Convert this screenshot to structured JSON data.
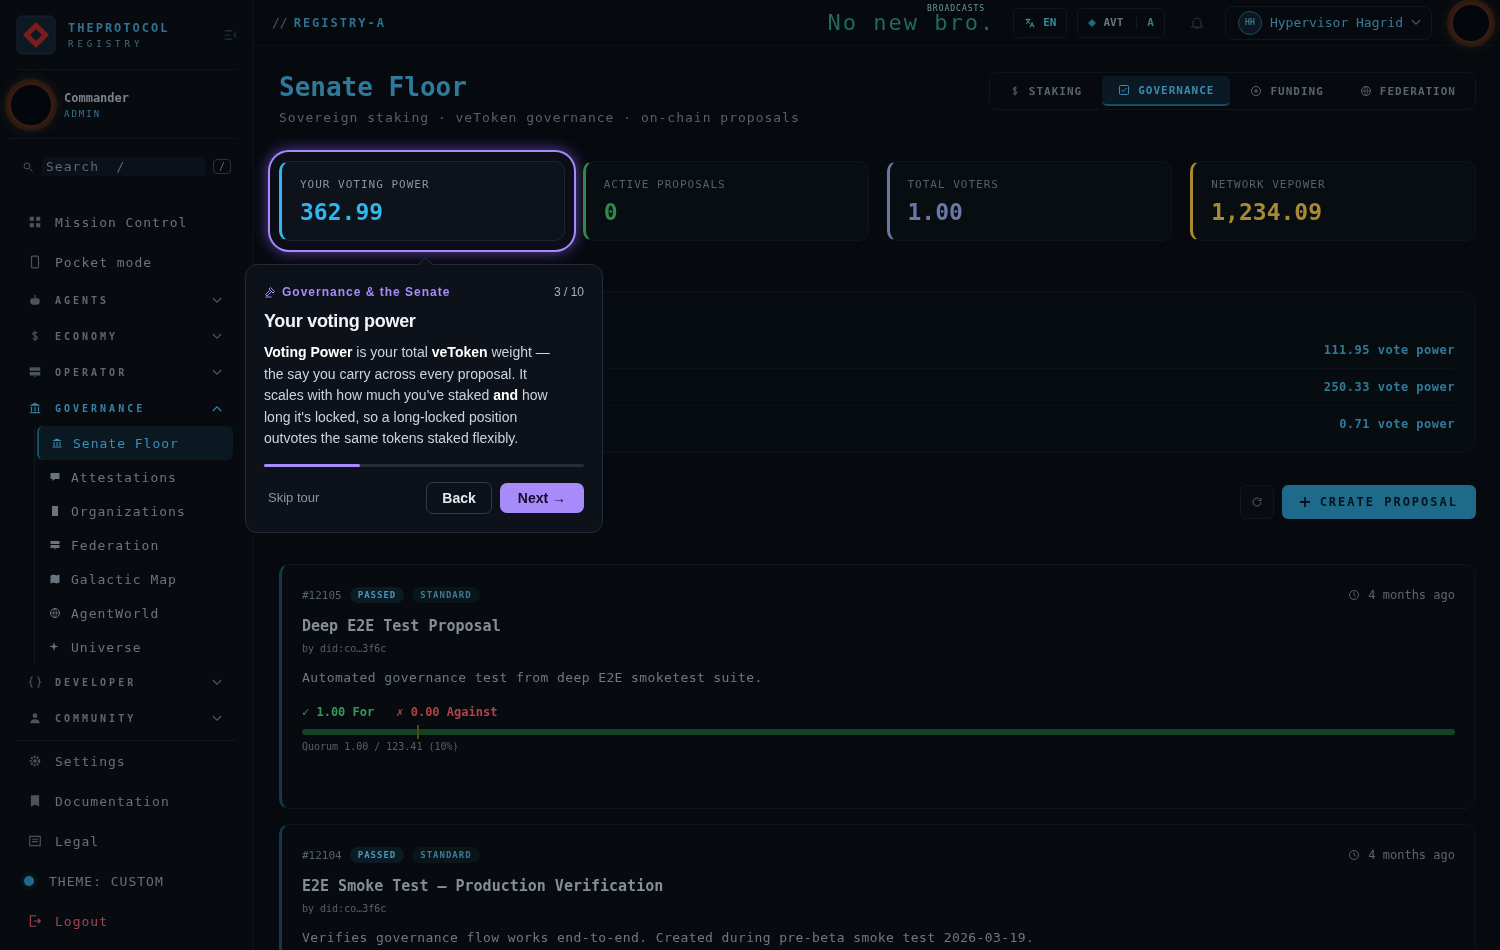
{
  "brand": {
    "name": "THEPROTOCOL",
    "sub": "REGISTRY"
  },
  "user": {
    "name": "Commander",
    "role": "ADMIN"
  },
  "search": {
    "placeholder": "Search  /",
    "shortcut": "/"
  },
  "nav": [
    {
      "kind": "link",
      "label": "Mission Control",
      "selected": false
    },
    {
      "kind": "link",
      "label": "Pocket mode",
      "selected": false
    },
    {
      "kind": "section",
      "label": "AGENTS",
      "expanded": false
    },
    {
      "kind": "section",
      "label": "ECONOMY",
      "expanded": false
    },
    {
      "kind": "section",
      "label": "OPERATOR",
      "expanded": false
    },
    {
      "kind": "section",
      "label": "GOVERNANCE",
      "expanded": true,
      "children": [
        {
          "label": "Senate Floor",
          "selected": true
        },
        {
          "label": "Attestations",
          "selected": false
        },
        {
          "label": "Organizations",
          "selected": false
        },
        {
          "label": "Federation",
          "selected": false
        },
        {
          "label": "Galactic Map",
          "selected": false
        },
        {
          "label": "AgentWorld",
          "selected": false
        },
        {
          "label": "Universe",
          "selected": false
        }
      ]
    },
    {
      "kind": "section",
      "label": "DEVELOPER",
      "expanded": false
    },
    {
      "kind": "section",
      "label": "COMMUNITY",
      "expanded": false
    }
  ],
  "footer": [
    {
      "kind": "link",
      "label": "Settings"
    },
    {
      "kind": "link",
      "label": "Documentation"
    },
    {
      "kind": "link",
      "label": "Legal"
    },
    {
      "kind": "theme",
      "label": "THEME: CUSTOM"
    },
    {
      "kind": "logout",
      "label": "Logout"
    }
  ],
  "header": {
    "prefix": "//",
    "crumb": "REGISTRY-A",
    "ticker_label": "BROADCASTS",
    "ticker": "No new bro.",
    "lang": "EN",
    "token": "AVT",
    "token_sub": "A",
    "user_initials": "HH",
    "user_name": "Hypervisor Hagrid"
  },
  "page": {
    "title": "Senate Floor",
    "subtitle": "Sovereign staking · veToken governance · on-chain proposals"
  },
  "tabs": [
    {
      "label": "STAKING",
      "selected": false
    },
    {
      "label": "GOVERNANCE",
      "selected": true
    },
    {
      "label": "FUNDING",
      "selected": false
    },
    {
      "label": "FEDERATION",
      "selected": false
    }
  ],
  "stats": [
    {
      "label": "YOUR VOTING POWER",
      "value": "362.99",
      "color": "#2fb8ee",
      "highlighted": true
    },
    {
      "label": "ACTIVE PROPOSALS",
      "value": "0",
      "color": "#2e8a48",
      "highlighted": false
    },
    {
      "label": "TOTAL VOTERS",
      "value": "1.00",
      "color": "#6a78a8",
      "highlighted": false
    },
    {
      "label": "NETWORK VEPOWER",
      "value": "1,234.09",
      "color": "#a88a30",
      "highlighted": false
    }
  ],
  "power_rows": [
    "111.95 vote power",
    "250.33 vote power",
    "0.71 vote power"
  ],
  "actions": {
    "create": "CREATE PROPOSAL"
  },
  "tour": {
    "category": "Governance & the Senate",
    "step": "3 / 10",
    "title": "Your voting power",
    "body": "**Voting Power** is your total **veToken** weight — the say you carry across every proposal. It scales with how much you've staked **and** how long it's locked, so a long-locked position outvotes the same tokens staked flexibly.",
    "level": 0.3,
    "skip": "Skip tour",
    "back": "Back",
    "next": "Next →"
  },
  "proposals": [
    {
      "id": "#12105",
      "status": "PASSED",
      "type": "STANDARD",
      "time": "4 months ago",
      "title": "Deep E2E Test Proposal",
      "author": "by did:co…3f6c",
      "description": "Automated governance test from deep E2E smoketest suite.",
      "votes_for": "✓ 1.00 For",
      "votes_against": "✗ 0.00 Against",
      "level": 1,
      "quorum_marker": {
        "level": 0.1
      },
      "quorum": "Quorum 1.00 / 123.41 (10%)"
    },
    {
      "id": "#12104",
      "status": "PASSED",
      "type": "STANDARD",
      "time": "4 months ago",
      "title": "E2E Smoke Test — Production Verification",
      "author": "by did:co…3f6c",
      "description": "Verifies governance flow works end-to-end. Created during pre-beta smoke test 2026-03-19."
    }
  ]
}
